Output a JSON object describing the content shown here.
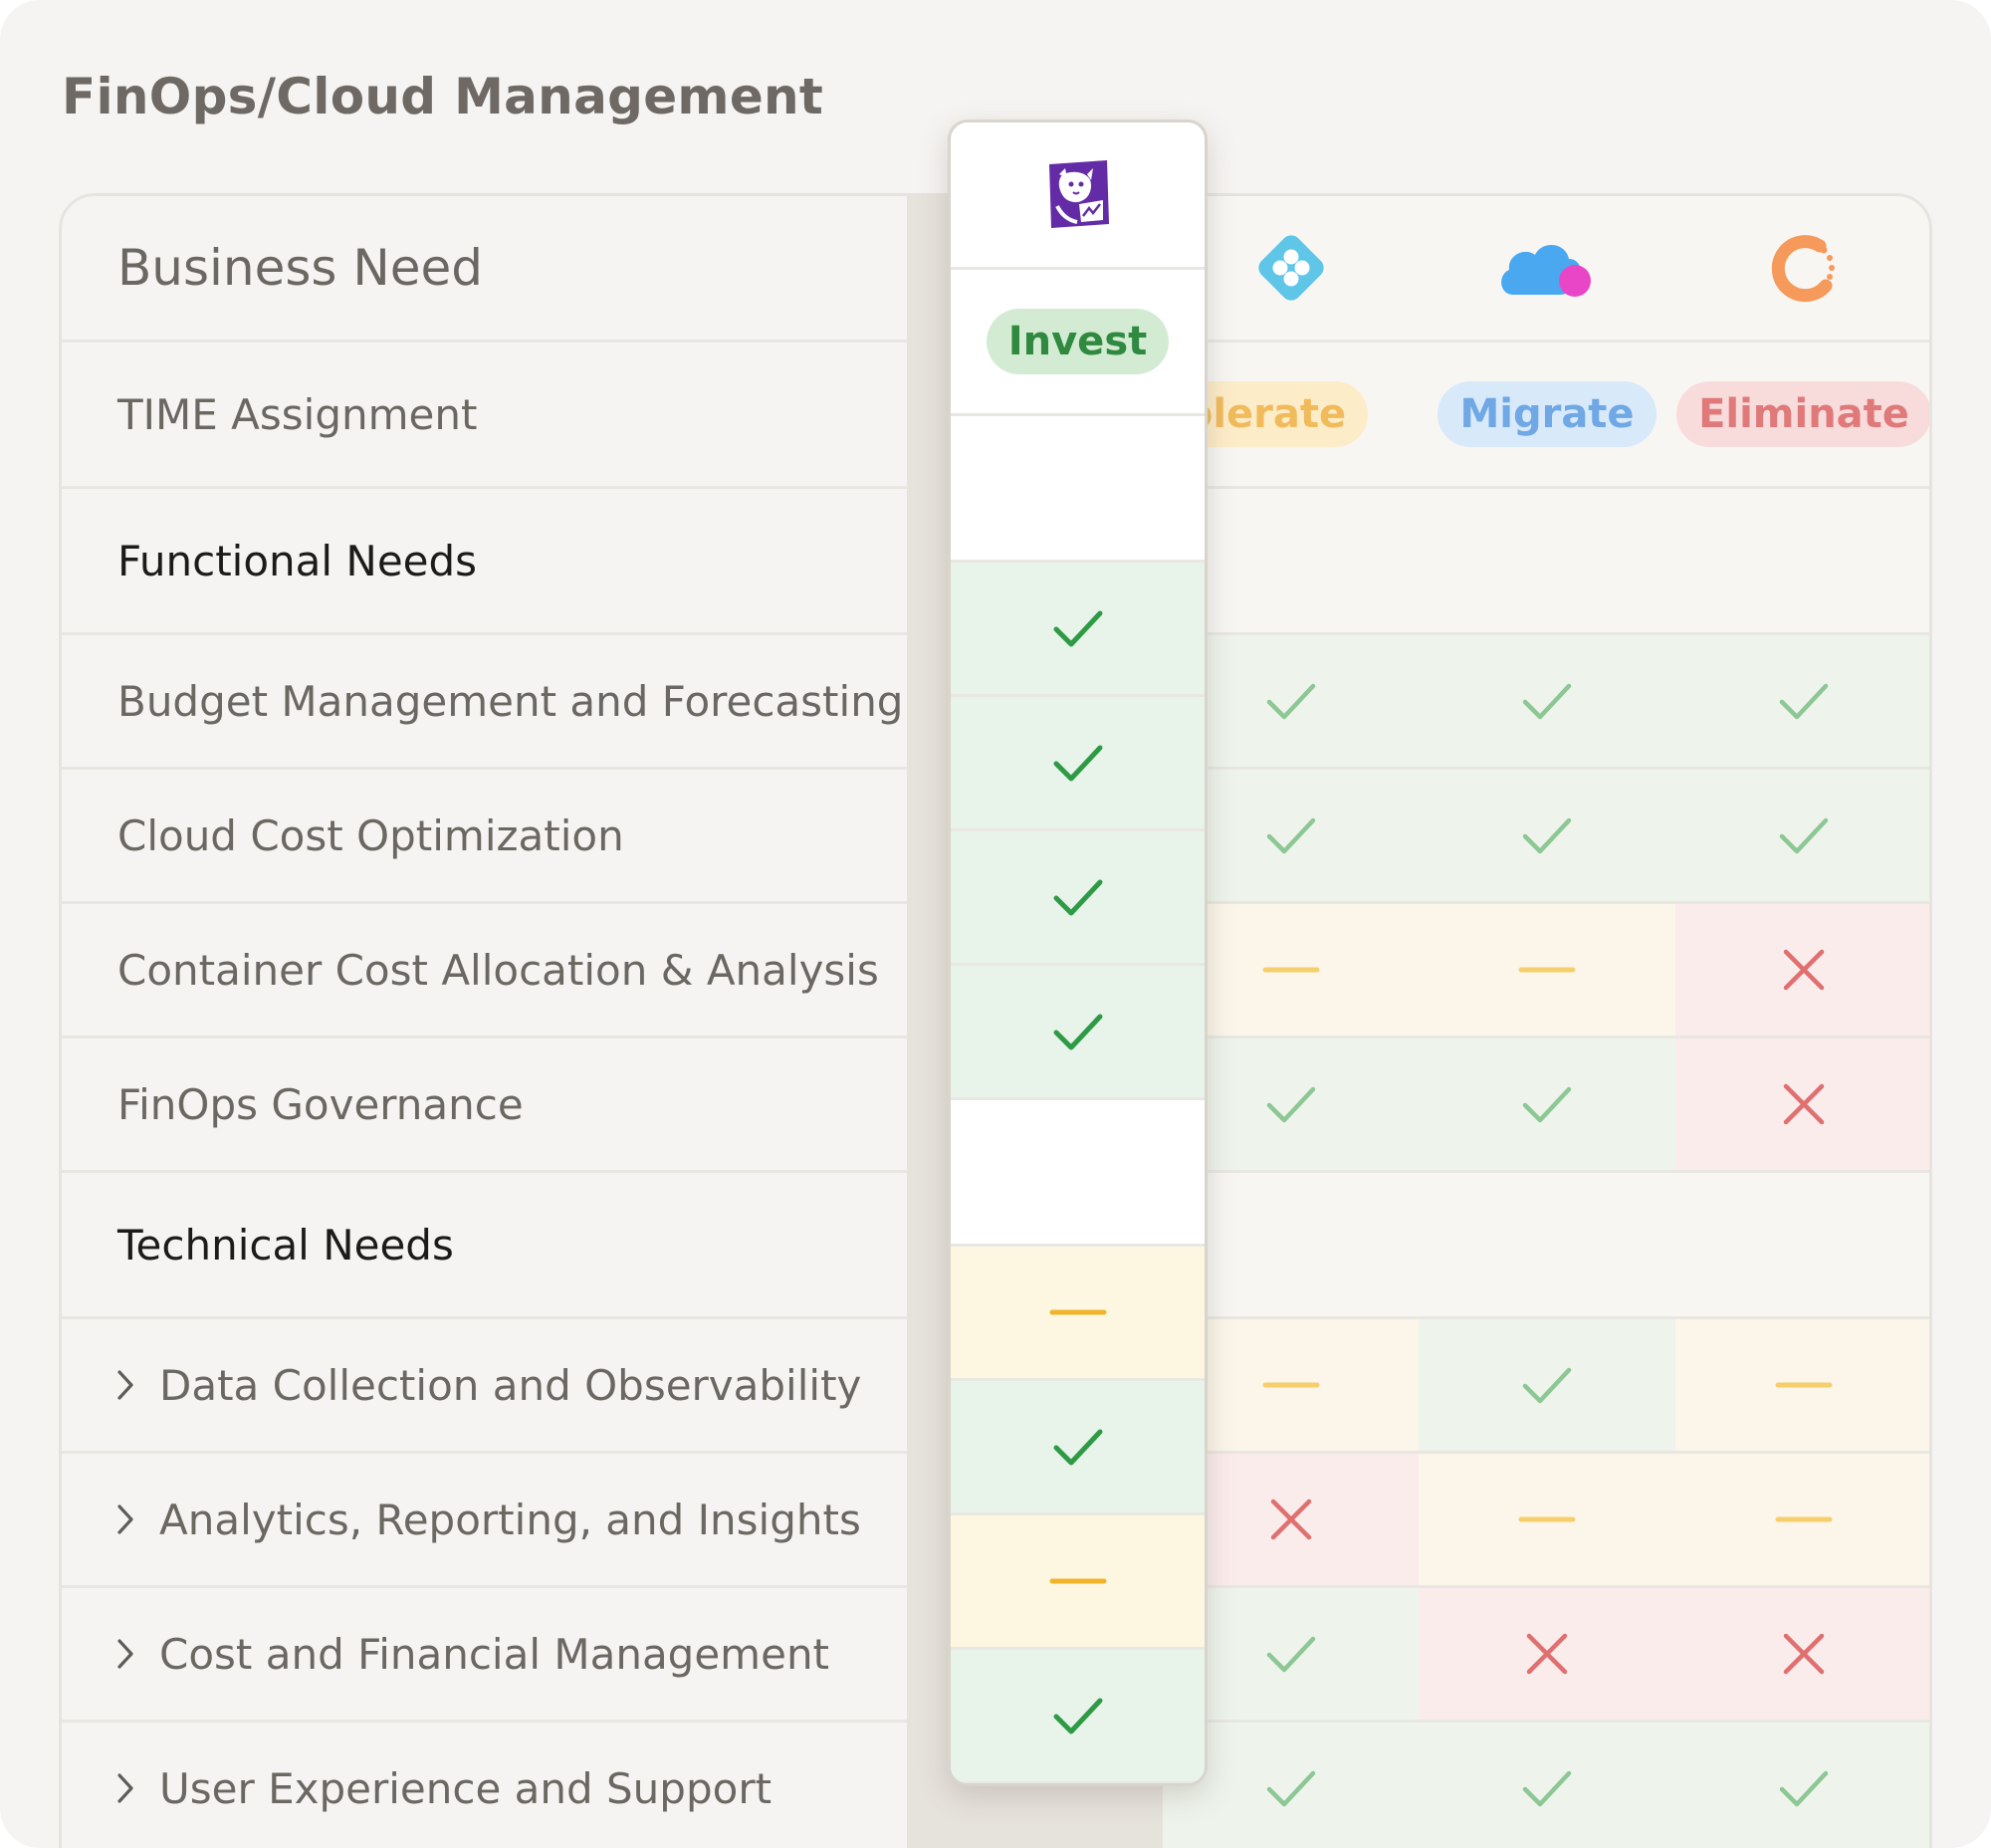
{
  "page_title": "FinOps/Cloud Management",
  "rows": {
    "business_need": "Business Need",
    "time_assignment": "TIME Assignment",
    "functional_needs": "Functional Needs",
    "budget": "Budget Management and Forecasting",
    "optimization": "Cloud Cost Optimization",
    "container": "Container Cost Allocation & Analysis",
    "governance": "FinOps Governance",
    "technical_needs": "Technical Needs",
    "data_collection": "Data Collection and Observability",
    "analytics": "Analytics, Reporting, and Insights",
    "cost_financial": "Cost and Financial Management",
    "user_experience": "User Experience and Support"
  },
  "vendors": [
    {
      "logo": "datadog-dog-logo",
      "assignment": "Invest",
      "pill_bg": "#d3ebd3",
      "pill_fg": "#2f8a3f"
    },
    {
      "logo": "blue-diamond-logo",
      "assignment": "Tolerate",
      "pill_bg": "#fdecc8",
      "pill_fg": "#f1bb5c"
    },
    {
      "logo": "cloud-pink-dot-logo",
      "assignment": "Migrate",
      "pill_bg": "#d8e9fa",
      "pill_fg": "#6fa8e4"
    },
    {
      "logo": "orange-ring-logo",
      "assignment": "Eliminate",
      "pill_bg": "#f8dcdc",
      "pill_fg": "#e07a7a"
    }
  ],
  "ratings": {
    "budget": [
      "check",
      "check",
      "check",
      "check"
    ],
    "optimization": [
      "check",
      "check",
      "check",
      "check"
    ],
    "container": [
      "check",
      "dash",
      "dash",
      "cross"
    ],
    "governance": [
      "check",
      "check",
      "check",
      "cross"
    ],
    "data_collection": [
      "dash",
      "dash",
      "check",
      "dash"
    ],
    "analytics": [
      "check",
      "cross",
      "dash",
      "dash"
    ],
    "cost_financial": [
      "dash",
      "check",
      "cross",
      "cross"
    ],
    "user_experience": [
      "check",
      "check",
      "check",
      "check"
    ]
  },
  "colors": {
    "check_strong": "#2e9a45",
    "check_soft": "#8cc794",
    "dash_strong": "#f0b429",
    "dash_soft": "#f6cf6c",
    "cross": "#e07070",
    "bg_check": "#eef4ec",
    "bg_check_featured": "#e8f4ea",
    "bg_dash": "#fbf6e9",
    "bg_dash_featured": "#fdf7e2",
    "bg_cross": "#fbecec"
  }
}
